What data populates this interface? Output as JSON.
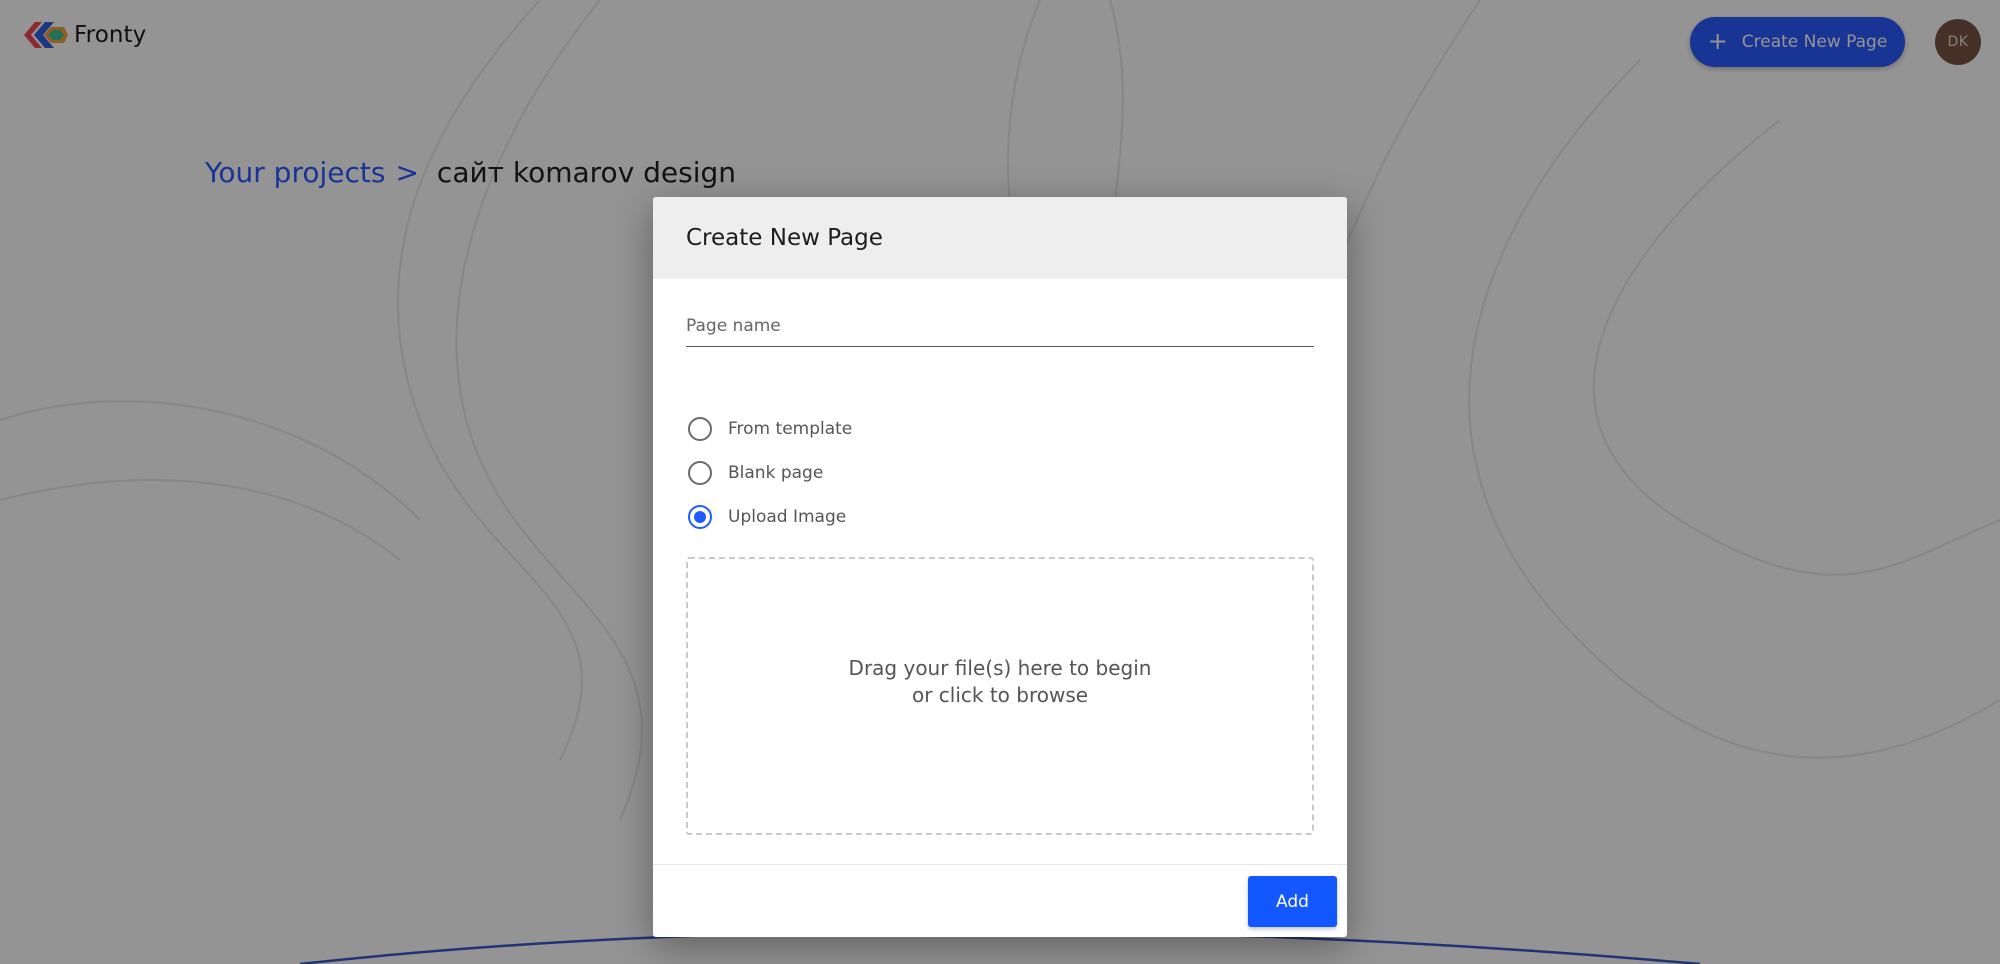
{
  "app": {
    "name": "Fronty"
  },
  "header": {
    "create_button_label": "Create New Page",
    "avatar_initials": "DK"
  },
  "breadcrumb": {
    "parent": "Your projects",
    "separator": ">",
    "current": "сайт komarov design"
  },
  "modal": {
    "title": "Create New Page",
    "page_name": {
      "value": "",
      "placeholder": "Page name"
    },
    "options": [
      {
        "label": "From template",
        "selected": false
      },
      {
        "label": "Blank page",
        "selected": false
      },
      {
        "label": "Upload Image",
        "selected": true
      }
    ],
    "dropzone": {
      "line1": "Drag your file(s) here to begin",
      "line2": "or click to browse"
    },
    "add_label": "Add"
  },
  "colors": {
    "accent": "#2a5bff",
    "button_primary": "#1257ff",
    "avatar_bg": "#7b5344"
  }
}
